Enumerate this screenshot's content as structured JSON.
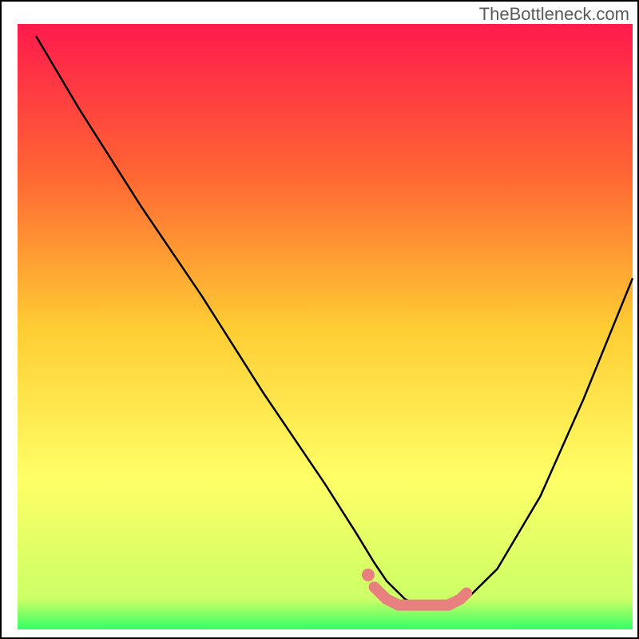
{
  "watermark": "TheBottleneck.com",
  "chart_data": {
    "type": "line",
    "title": "",
    "xlabel": "",
    "ylabel": "",
    "xlim": [
      0,
      100
    ],
    "ylim": [
      0,
      100
    ],
    "gradient_stops": [
      {
        "offset": 0,
        "color": "#ff1a4d"
      },
      {
        "offset": 25,
        "color": "#ff6633"
      },
      {
        "offset": 50,
        "color": "#ffcc33"
      },
      {
        "offset": 75,
        "color": "#ffff66"
      },
      {
        "offset": 95,
        "color": "#ccff66"
      },
      {
        "offset": 100,
        "color": "#33ff66"
      }
    ],
    "series": [
      {
        "name": "bottleneck-curve",
        "color": "#000000",
        "x": [
          3,
          10,
          20,
          30,
          40,
          50,
          55,
          58,
          60,
          63,
          65,
          68,
          70,
          73,
          78,
          85,
          92,
          100
        ],
        "y": [
          98,
          86,
          70,
          55,
          39,
          24,
          16,
          11,
          8,
          5,
          4,
          4,
          4,
          5,
          10,
          22,
          38,
          58
        ]
      },
      {
        "name": "optimal-zone-marker",
        "color": "#e88080",
        "type": "scatter",
        "x": [
          58,
          60,
          62,
          64,
          66,
          68,
          70,
          72,
          73
        ],
        "y": [
          7,
          5,
          4,
          4,
          4,
          4,
          4,
          5,
          6
        ]
      }
    ],
    "annotations": []
  }
}
